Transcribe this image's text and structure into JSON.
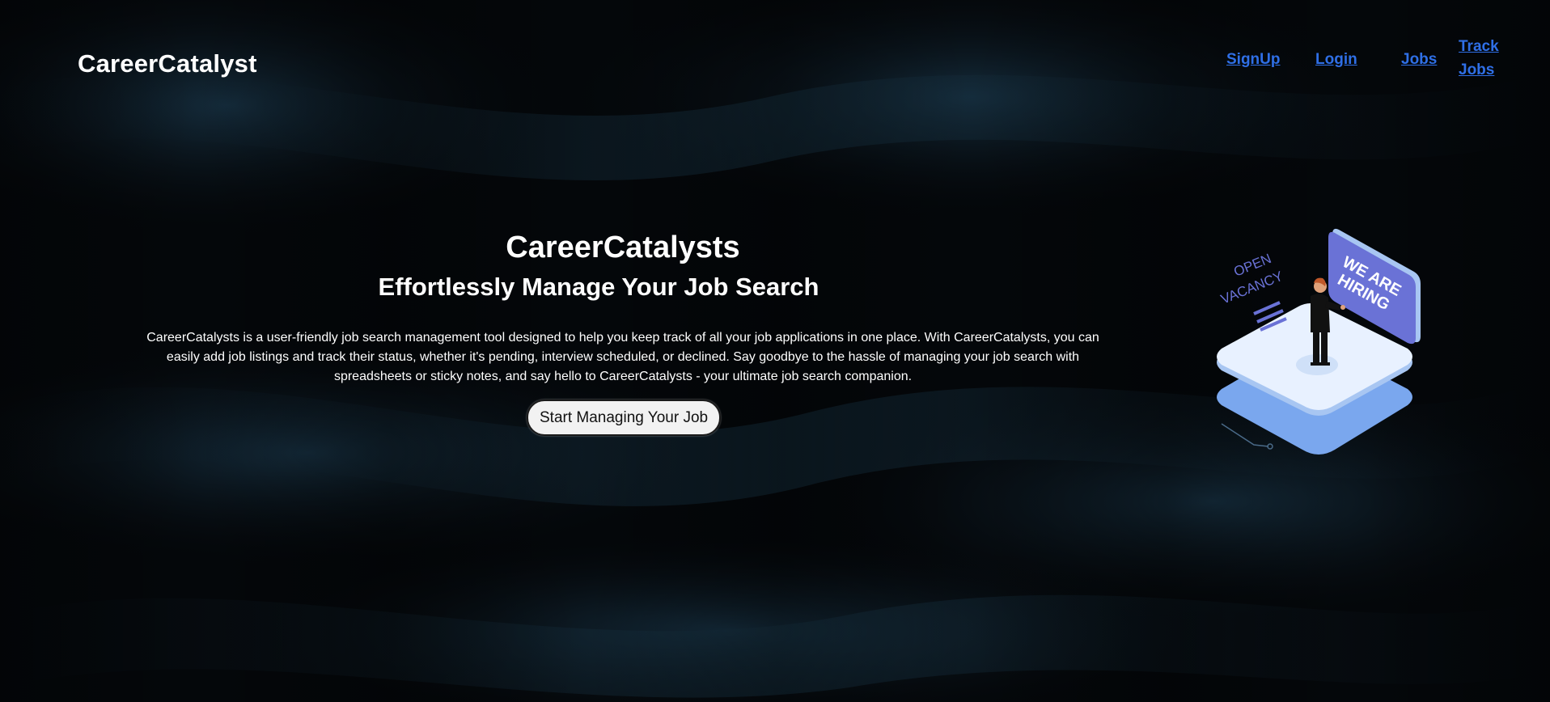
{
  "brand": {
    "logo_text": "CareerCatalyst"
  },
  "nav": {
    "signup": "SignUp",
    "login": "Login",
    "jobs": "Jobs",
    "track_jobs": "Track Jobs"
  },
  "hero": {
    "title": "CareerCatalysts",
    "subtitle": "Effortlessly Manage Your Job Search",
    "description": "CareerCatalysts is a user-friendly job search management tool designed to help you keep track of all your job applications in one place. With CareerCatalysts, you can easily add job listings and track their status, whether it's pending, interview scheduled, or declined. Say goodbye to the hassle of managing your job search with spreadsheets or sticky notes, and say hello to CareerCatalysts - your ultimate job search companion.",
    "cta_label": "Start Managing Your Job"
  },
  "illustration": {
    "sign_text_line1": "WE ARE",
    "sign_text_line2": "HIRING",
    "tag_text_line1": "OPEN",
    "tag_text_line2": "VACANCY"
  },
  "colors": {
    "background": "#04070a",
    "link": "#2f6fe6",
    "button_bg": "#f2f2f2",
    "sign_purple": "#6a72d6",
    "platform_light": "#e8f1ff",
    "platform_blue": "#7aa7ee"
  }
}
